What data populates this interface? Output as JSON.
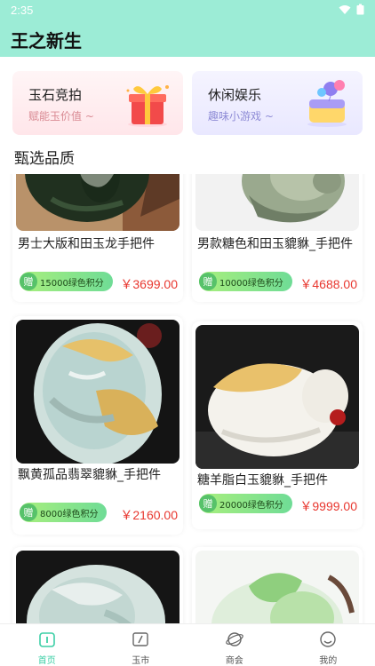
{
  "status": {
    "time": "2:35"
  },
  "app": {
    "title": "王之新生"
  },
  "promos": [
    {
      "title": "玉石竞拍",
      "subtitle": "赋能玉价值 ~",
      "icon": "gift-box-icon"
    },
    {
      "title": "休闲娱乐",
      "subtitle": "趣味小游戏 ~",
      "icon": "game-balloon-icon"
    }
  ],
  "section": {
    "title": "甄选品质"
  },
  "products": [
    {
      "name": "男士大版和田玉龙手把件",
      "points_icon": "赠",
      "points": "15000绿色积分",
      "price": "￥3699.00"
    },
    {
      "name": "男款糖色和田玉貔貅_手把件",
      "points_icon": "赠",
      "points": "10000绿色积分",
      "price": "￥4688.00"
    },
    {
      "name": "飘黄孤品翡翠貔貅_手把件",
      "points_icon": "赠",
      "points": "8000绿色积分",
      "price": "￥2160.00"
    },
    {
      "name": "糖羊脂白玉貔貅_手把件",
      "points_icon": "赠",
      "points": "20000绿色积分",
      "price": "￥9999.00"
    }
  ],
  "tabs": [
    {
      "label": "首页",
      "icon": "home-icon"
    },
    {
      "label": "玉市",
      "icon": "market-icon"
    },
    {
      "label": "商会",
      "icon": "planet-icon"
    },
    {
      "label": "我的",
      "icon": "profile-icon"
    }
  ]
}
